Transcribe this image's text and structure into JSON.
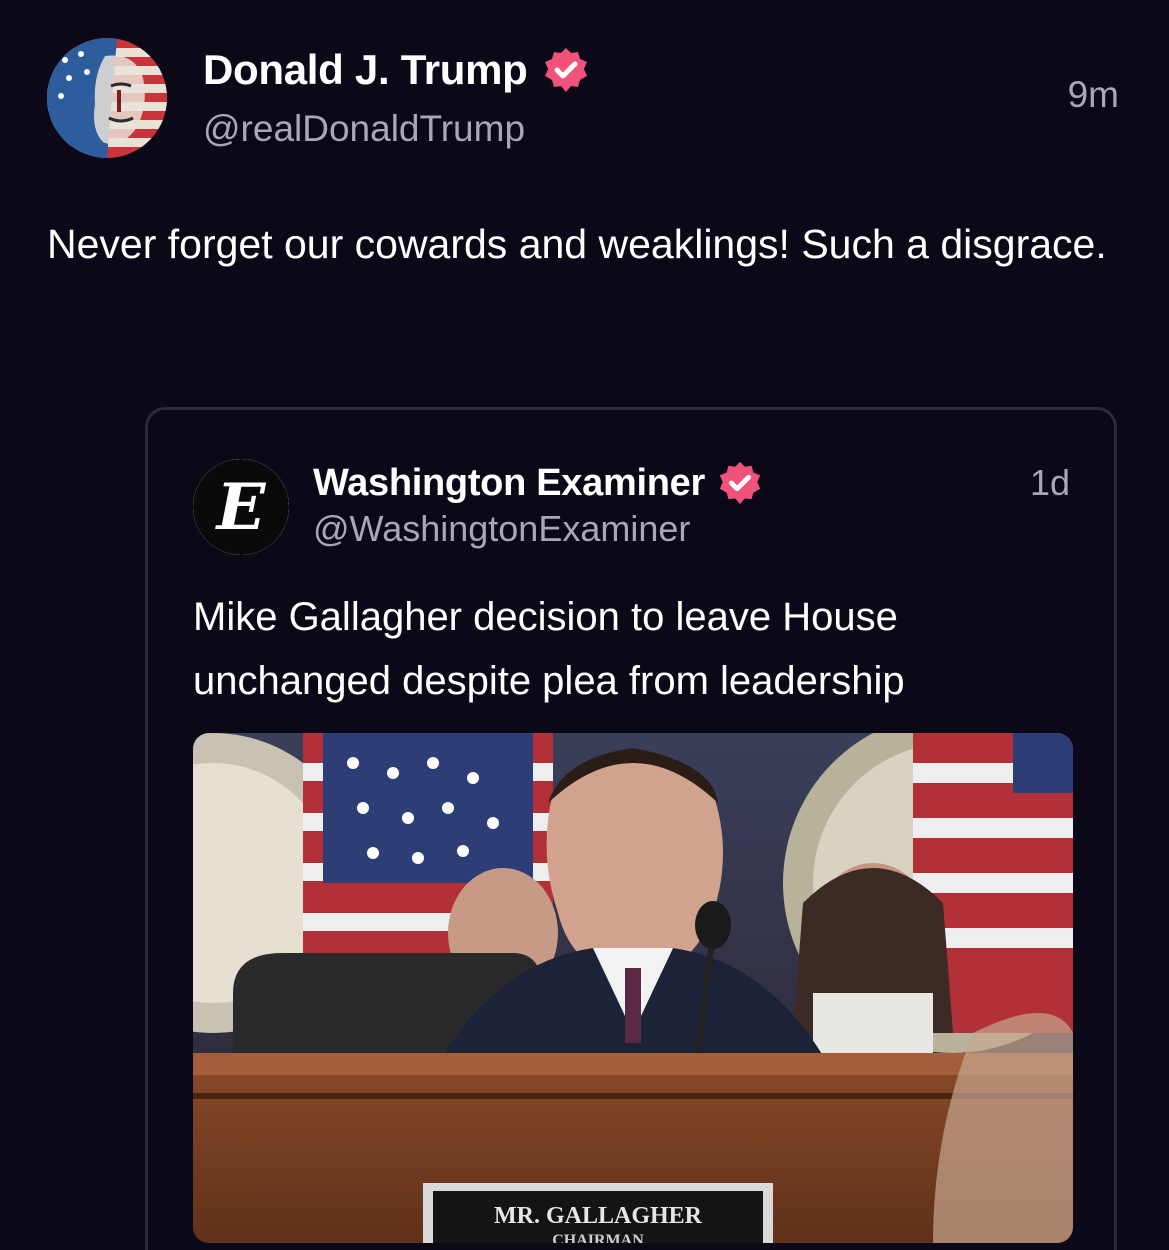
{
  "post": {
    "author_name": "Donald J. Trump",
    "handle": "@realDonaldTrump",
    "timestamp": "9m",
    "text": "Never forget our cowards and weaklings! Such a disgrace.",
    "avatar_icon": "patriotic-portrait-avatar",
    "verified_icon": "verified-badge-icon"
  },
  "quote": {
    "author_name": "Washington Examiner",
    "handle": "@WashingtonExaminer",
    "timestamp": "1d",
    "text": "Mike Gallagher decision to leave House unchanged despite plea from leadership",
    "avatar_icon": "blackletter-e-logo",
    "image_nameplate": "MR. GALLAGHER",
    "image_nameplate_sub": "CHAIRMAN"
  },
  "colors": {
    "background": "#0b0818",
    "verified_badge": "#f0527a",
    "muted_text": "#a9a7b5",
    "card_border": "#2c2840"
  }
}
